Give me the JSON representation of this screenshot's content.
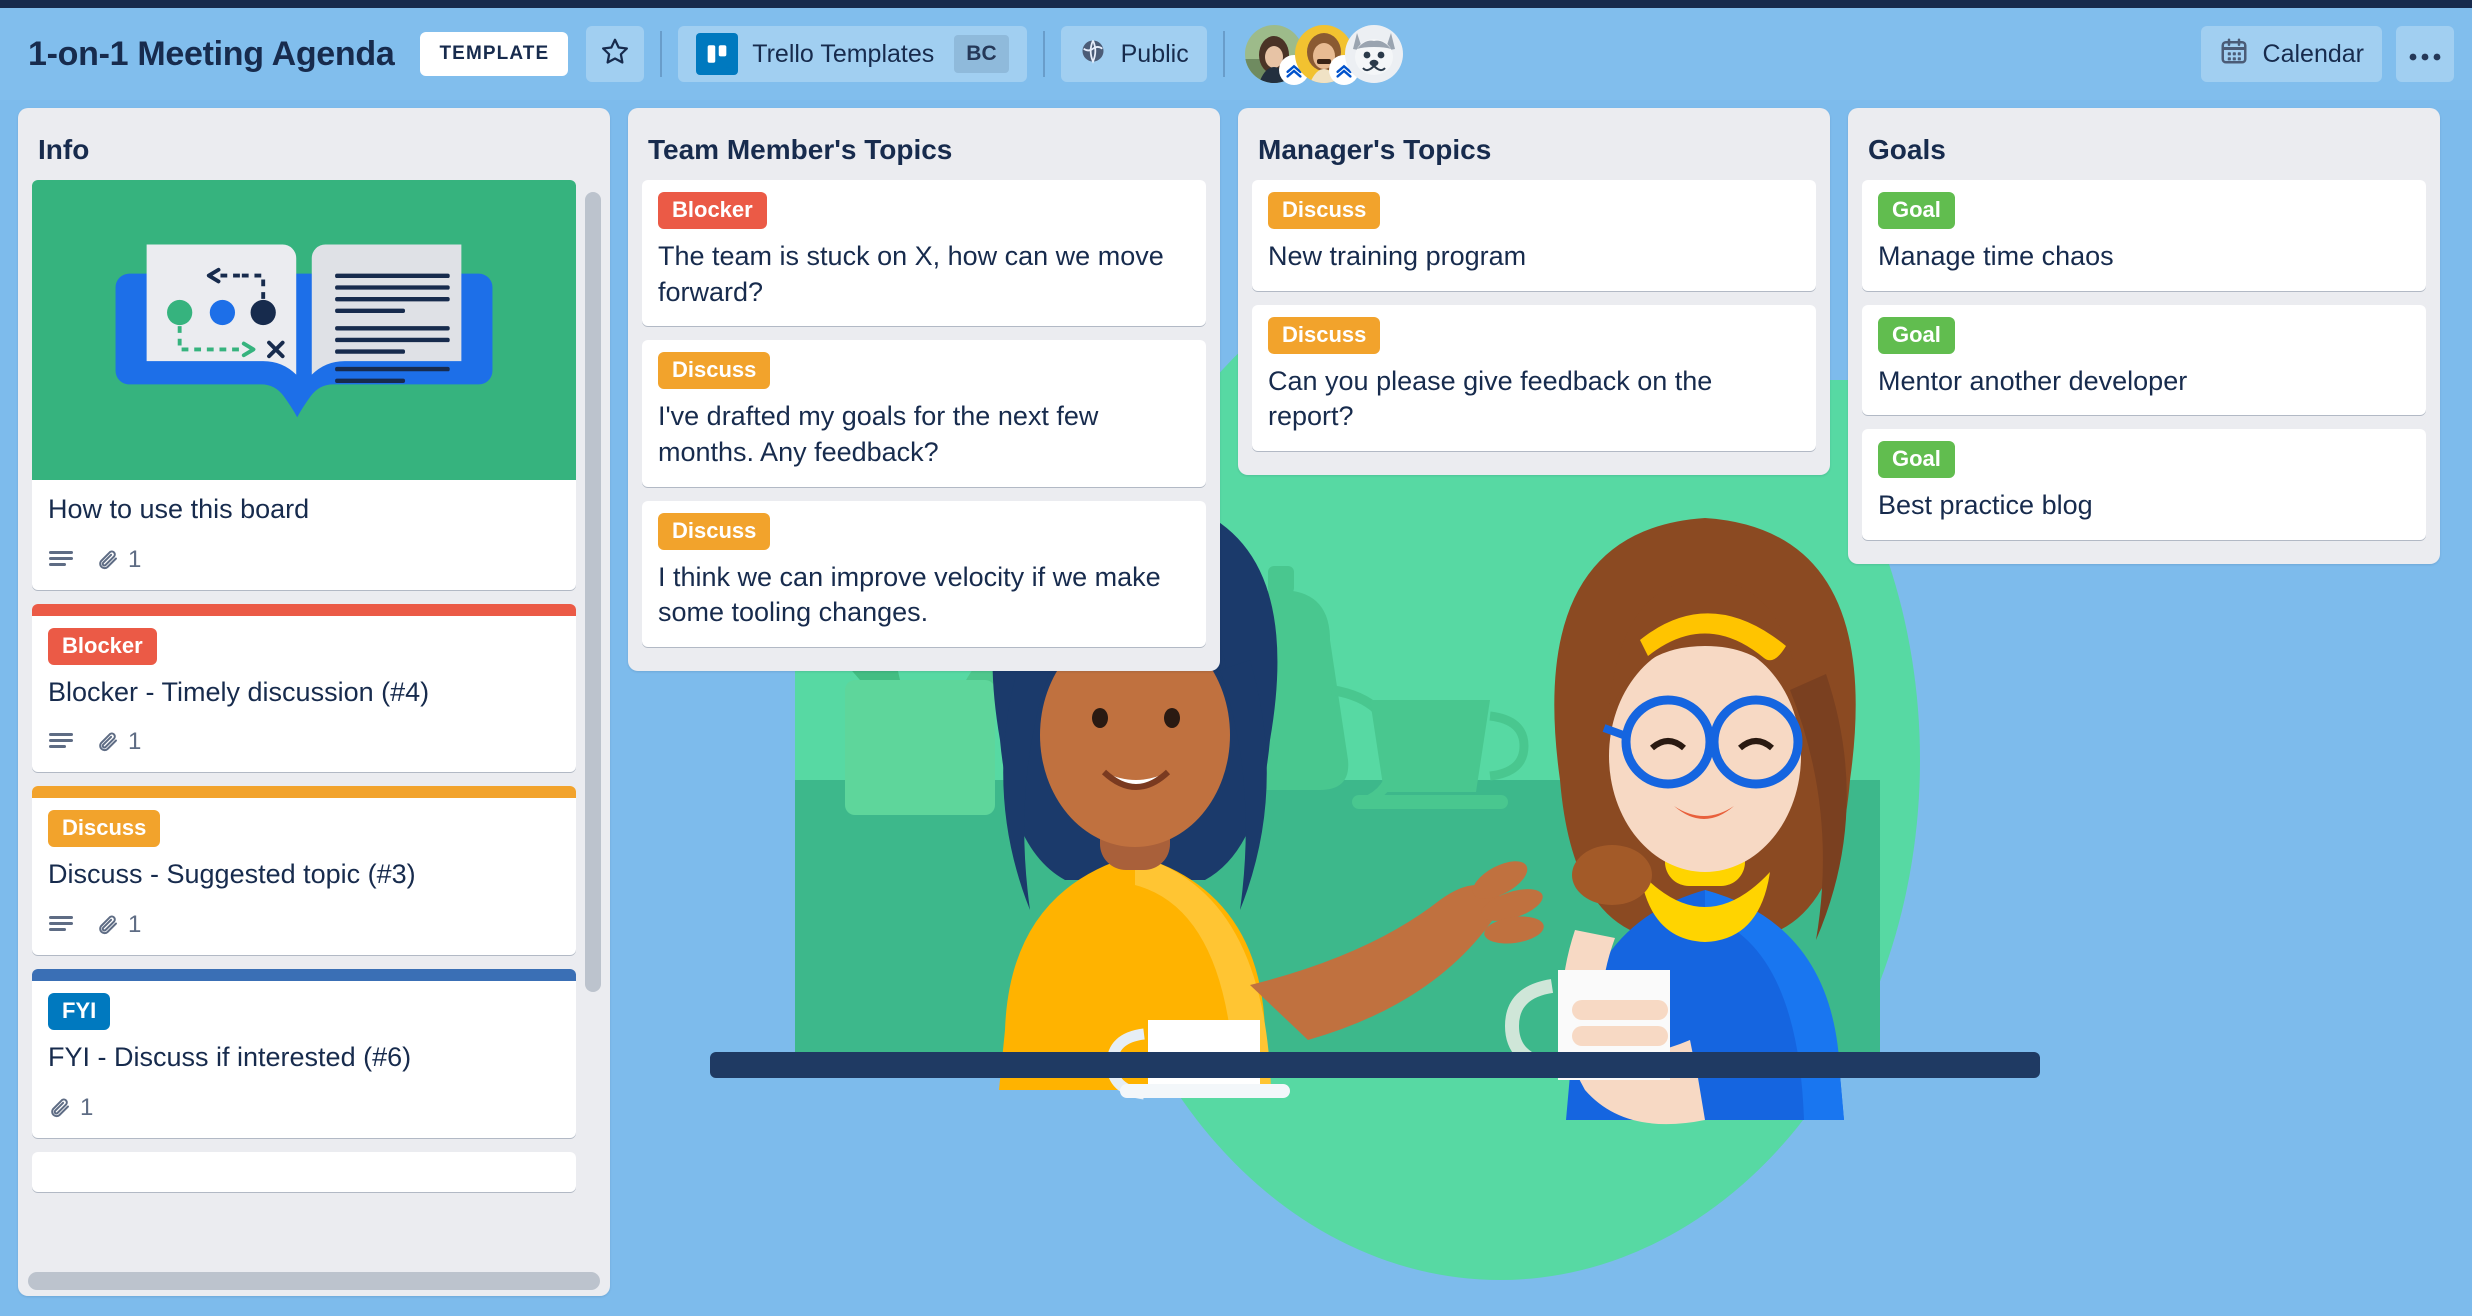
{
  "header": {
    "board_title": "1-on-1 Meeting Agenda",
    "template_badge": "TEMPLATE",
    "star_icon": "star-icon",
    "workspace_name": "Trello Templates",
    "workspace_initials": "BC",
    "visibility": "Public",
    "visibility_icon": "globe-icon",
    "calendar_label": "Calendar",
    "calendar_icon": "calendar-icon",
    "more_icon": "ellipsis-icon",
    "members": [
      {
        "name": "member-avatar-1",
        "badge": "chevron-up-badge"
      },
      {
        "name": "member-avatar-2",
        "badge": "chevron-up-badge"
      },
      {
        "name": "member-avatar-3",
        "badge": "none"
      }
    ]
  },
  "colors": {
    "board_background": "#7dbbec",
    "top_strip": "#172b4d",
    "list_background": "#ebecf0",
    "card_background": "#ffffff",
    "text_primary": "#172b4d",
    "text_muted": "#5e6c84",
    "label_blocker": "#eb5a46",
    "label_discuss": "#f2a32c",
    "label_fyi": "#0079bf",
    "label_goal": "#61bd4f",
    "cover_green": "#36b37e",
    "scrollbar": "#bcc3cd"
  },
  "lists": [
    {
      "title": "Info",
      "has_scrollbar": true,
      "cards": [
        {
          "type": "cover",
          "cover_icon": "open-book-icon",
          "cover_color": "#36b37e",
          "title": "How to use this board",
          "badges": {
            "description": true,
            "attachments": "1"
          }
        },
        {
          "type": "plain",
          "colorbar": "#eb5a46",
          "label": {
            "text": "Blocker",
            "color": "#eb5a46"
          },
          "title": "Blocker - Timely discussion (#4)",
          "badges": {
            "description": true,
            "attachments": "1"
          }
        },
        {
          "type": "plain",
          "colorbar": "#f2a32c",
          "label": {
            "text": "Discuss",
            "color": "#f2a32c"
          },
          "title": "Discuss - Suggested topic (#3)",
          "badges": {
            "description": true,
            "attachments": "1"
          }
        },
        {
          "type": "plain",
          "colorbar": "#3a6fb5",
          "label": {
            "text": "FYI",
            "color": "#0079bf"
          },
          "title": "FYI - Discuss if interested (#6)",
          "badges": {
            "description": false,
            "attachments": "1"
          }
        }
      ]
    },
    {
      "title": "Team Member's Topics",
      "has_scrollbar": false,
      "cards": [
        {
          "type": "plain",
          "label": {
            "text": "Blocker",
            "color": "#eb5a46"
          },
          "title": "The team is stuck on X, how can we move forward?",
          "badges": {
            "description": false,
            "attachments": null
          }
        },
        {
          "type": "plain",
          "label": {
            "text": "Discuss",
            "color": "#f2a32c"
          },
          "title": "I've drafted my goals for the next few months. Any feedback?",
          "badges": {
            "description": false,
            "attachments": null
          }
        },
        {
          "type": "plain",
          "label": {
            "text": "Discuss",
            "color": "#f2a32c"
          },
          "title": "I think we can improve velocity if we make some tooling changes.",
          "badges": {
            "description": false,
            "attachments": null
          }
        }
      ]
    },
    {
      "title": "Manager's Topics",
      "has_scrollbar": false,
      "cards": [
        {
          "type": "plain",
          "label": {
            "text": "Discuss",
            "color": "#f2a32c"
          },
          "title": "New training program",
          "badges": {
            "description": false,
            "attachments": null
          }
        },
        {
          "type": "plain",
          "label": {
            "text": "Discuss",
            "color": "#f2a32c"
          },
          "title": "Can you please give feedback on the report?",
          "badges": {
            "description": false,
            "attachments": null
          }
        }
      ]
    },
    {
      "title": "Goals",
      "has_scrollbar": false,
      "cards": [
        {
          "type": "plain",
          "label": {
            "text": "Goal",
            "color": "#61bd4f"
          },
          "title": "Manage time chaos",
          "badges": {
            "description": false,
            "attachments": null
          }
        },
        {
          "type": "plain",
          "label": {
            "text": "Goal",
            "color": "#61bd4f"
          },
          "title": "Mentor another developer",
          "badges": {
            "description": false,
            "attachments": null
          }
        },
        {
          "type": "plain",
          "label": {
            "text": "Goal",
            "color": "#61bd4f"
          },
          "title": "Best practice blog",
          "badges": {
            "description": false,
            "attachments": null
          }
        }
      ]
    }
  ]
}
